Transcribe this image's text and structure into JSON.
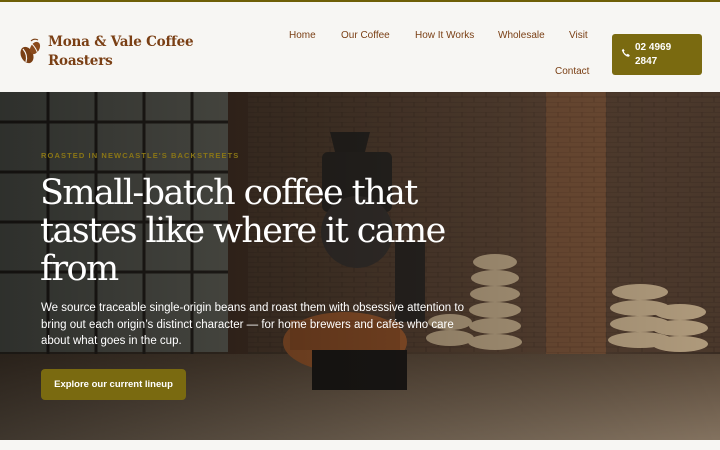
{
  "brand": {
    "name_line1": "Mona & Vale Coffee",
    "name_line2": "Roasters",
    "logo_icon": "coffee-beans-icon"
  },
  "nav": {
    "items": [
      {
        "label": "Home"
      },
      {
        "label": "Our Coffee"
      },
      {
        "label": "How It Works"
      },
      {
        "label": "Wholesale"
      },
      {
        "label": "Visit"
      },
      {
        "label": "Contact"
      }
    ],
    "phone": {
      "line1": "02 4969",
      "line2": "2847",
      "icon": "phone-icon"
    }
  },
  "hero": {
    "eyebrow": "ROASTED IN NEWCASTLE'S BACKSTREETS",
    "headline": "Small-batch coffee that tastes like where it came from",
    "lede": "We source traceable single-origin beans and roast them with obsessive attention to bring out each origin’s distinct character — for home brewers and cafés who care about what goes in the cup.",
    "cta_label": "Explore our current lineup"
  },
  "colors": {
    "accent": "#7a6a10",
    "brand_brown": "#7a3f14",
    "header_bg": "#f7f6f3",
    "eyebrow": "#8a7616"
  }
}
